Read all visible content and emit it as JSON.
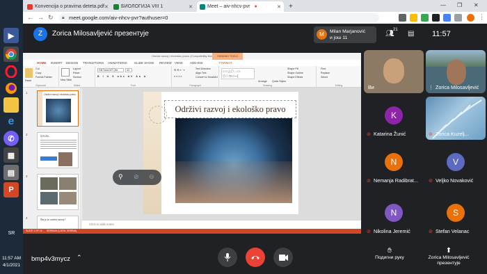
{
  "taskbar": {
    "lang": "SR",
    "time": "11:57 AM",
    "date": "4/1/2021"
  },
  "browser": {
    "tabs": [
      {
        "label": "Konvencija o pravima deteta.pdf",
        "active": false
      },
      {
        "label": "БИОЛОГИЈА VIII 1",
        "active": false
      },
      {
        "label": "Meet – aiv-nhcv-pvr",
        "active": true
      }
    ],
    "new_tab": "+",
    "url": "meet.google.com/aiv-nhcv-pvr?authuser=0"
  },
  "meet": {
    "presenter_initial": "Z",
    "presenter_title": "Zorica Milosavljević презентује",
    "notification": {
      "initial": "M",
      "line1": "Milan Marjanović",
      "line2": "и још 11"
    },
    "participant_count": "21",
    "clock": "11:57",
    "tiles": [
      {
        "name": "Ви",
        "initial": ""
      },
      {
        "name": "Zorica Milosavljević",
        "initial": ""
      },
      {
        "name": "Katarina Žunić",
        "initial": "K",
        "color": "#8e24aa"
      },
      {
        "name": "Zorica Kuzelj...",
        "initial": ""
      },
      {
        "name": "Nemanja Radibrat...",
        "initial": "N",
        "color": "#e8710a"
      },
      {
        "name": "Veljko Novaković",
        "initial": "V",
        "color": "#5c6bc0"
      },
      {
        "name": "Nikolina Jeremić",
        "initial": "N",
        "color": "#7e57c2"
      },
      {
        "name": "Stefan Velanac",
        "initial": "S",
        "color": "#e8710a"
      }
    ],
    "bottom": {
      "meeting_code": "bmp4v3mycz",
      "raise_hand": "Подигни руку",
      "presenting_line1": "Zorica Milosavljević",
      "presenting_line2": "презентује"
    }
  },
  "ppt": {
    "window_title": "Održivi razvoj i ekološko pravo (Compatibility Mode) - PowerPoint",
    "drawing_tools": "DRAWING TOOLS",
    "menu": [
      "FILE",
      "HOME",
      "INSERT",
      "DESIGN",
      "TRANSITIONS",
      "ANIMATIONS",
      "SLIDE SHOW",
      "REVIEW",
      "VIEW",
      "ADD-INS",
      "FORMAT"
    ],
    "ribbon": {
      "cut": "Cut",
      "copy": "Copy",
      "format_painter": "Format Painter",
      "paste": "Paste",
      "new_slide": "New Slide",
      "layout": "Layout",
      "reset": "Reset",
      "section": "Section",
      "font": "Gill Sans MT (He",
      "font_size": "43",
      "text_direction": "Text Direction",
      "align_text": "Align Text",
      "smartart": "Convert to SmartArt",
      "arrange": "Arrange",
      "quick_styles": "Quick Styles",
      "shape_fill": "Shape Fill",
      "shape_outline": "Shape Outline",
      "shape_effects": "Shape Effects",
      "find": "Find",
      "replace": "Replace",
      "select": "Select",
      "groups": [
        "Clipboard",
        "Slides",
        "Font",
        "Paragraph",
        "Drawing",
        "Editing"
      ]
    },
    "thumbs": [
      {
        "num": "1",
        "text": "Održivi razvoj i ekološko pravo"
      },
      {
        "num": "2",
        "text": "ČOVEK..."
      },
      {
        "num": "3",
        "text": ""
      },
      {
        "num": "4",
        "text": "Šta je to održivi razvoj?"
      }
    ],
    "slide_title": "Održivi razvoj i ekološko pravo",
    "notes": "Click to add notes",
    "status_slide": "SLIDE 1 OF 16",
    "status_lang": "SERBIAN (LATIN, SERBIA)"
  }
}
